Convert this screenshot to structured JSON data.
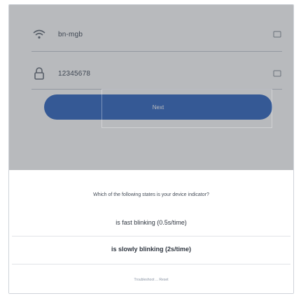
{
  "form": {
    "wifi_name": "bn-mgb",
    "password": "12345678",
    "next_label": "Next"
  },
  "sheet": {
    "question": "Which of the following states is your device indicator?",
    "options": [
      {
        "label": "is fast blinking  (0.5s/time)"
      },
      {
        "label": "is slowly blinking  (2s/time)"
      }
    ],
    "footer": "Troubleshoot ... Reset"
  },
  "icons": {
    "wifi": "wifi-icon",
    "lock": "lock-icon",
    "switch": "switch-network-icon",
    "eye": "password-visibility-icon"
  },
  "colors": {
    "primary": "#3d6fc4",
    "overlay": "#282d37",
    "text": "#2f3640"
  }
}
